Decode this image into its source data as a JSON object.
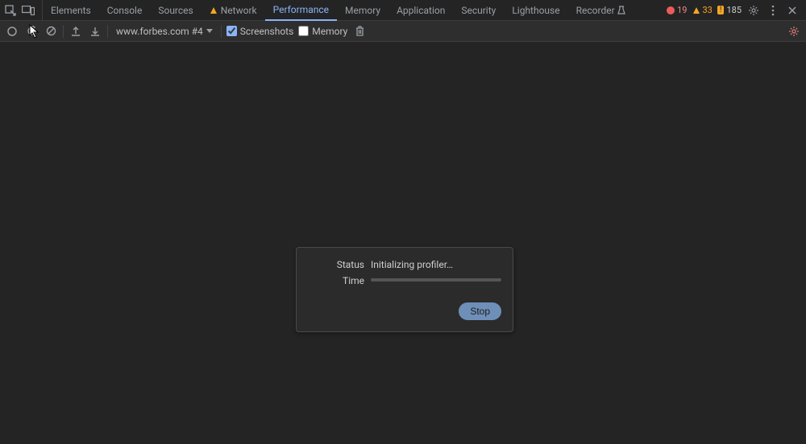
{
  "topbar": {
    "tabs": [
      {
        "label": "Elements"
      },
      {
        "label": "Console"
      },
      {
        "label": "Sources"
      },
      {
        "label": "Network",
        "warn": true
      },
      {
        "label": "Performance",
        "active": true
      },
      {
        "label": "Memory"
      },
      {
        "label": "Application"
      },
      {
        "label": "Security"
      },
      {
        "label": "Lighthouse"
      },
      {
        "label": "Recorder",
        "flask": true
      }
    ],
    "errors": "19",
    "warnings": "33",
    "messages": "185"
  },
  "toolbar": {
    "target": "www.forbes.com #4",
    "screenshots_label": "Screenshots",
    "memory_label": "Memory"
  },
  "dialog": {
    "status_label": "Status",
    "status_value": "Initializing profiler…",
    "time_label": "Time",
    "stop_label": "Stop"
  }
}
